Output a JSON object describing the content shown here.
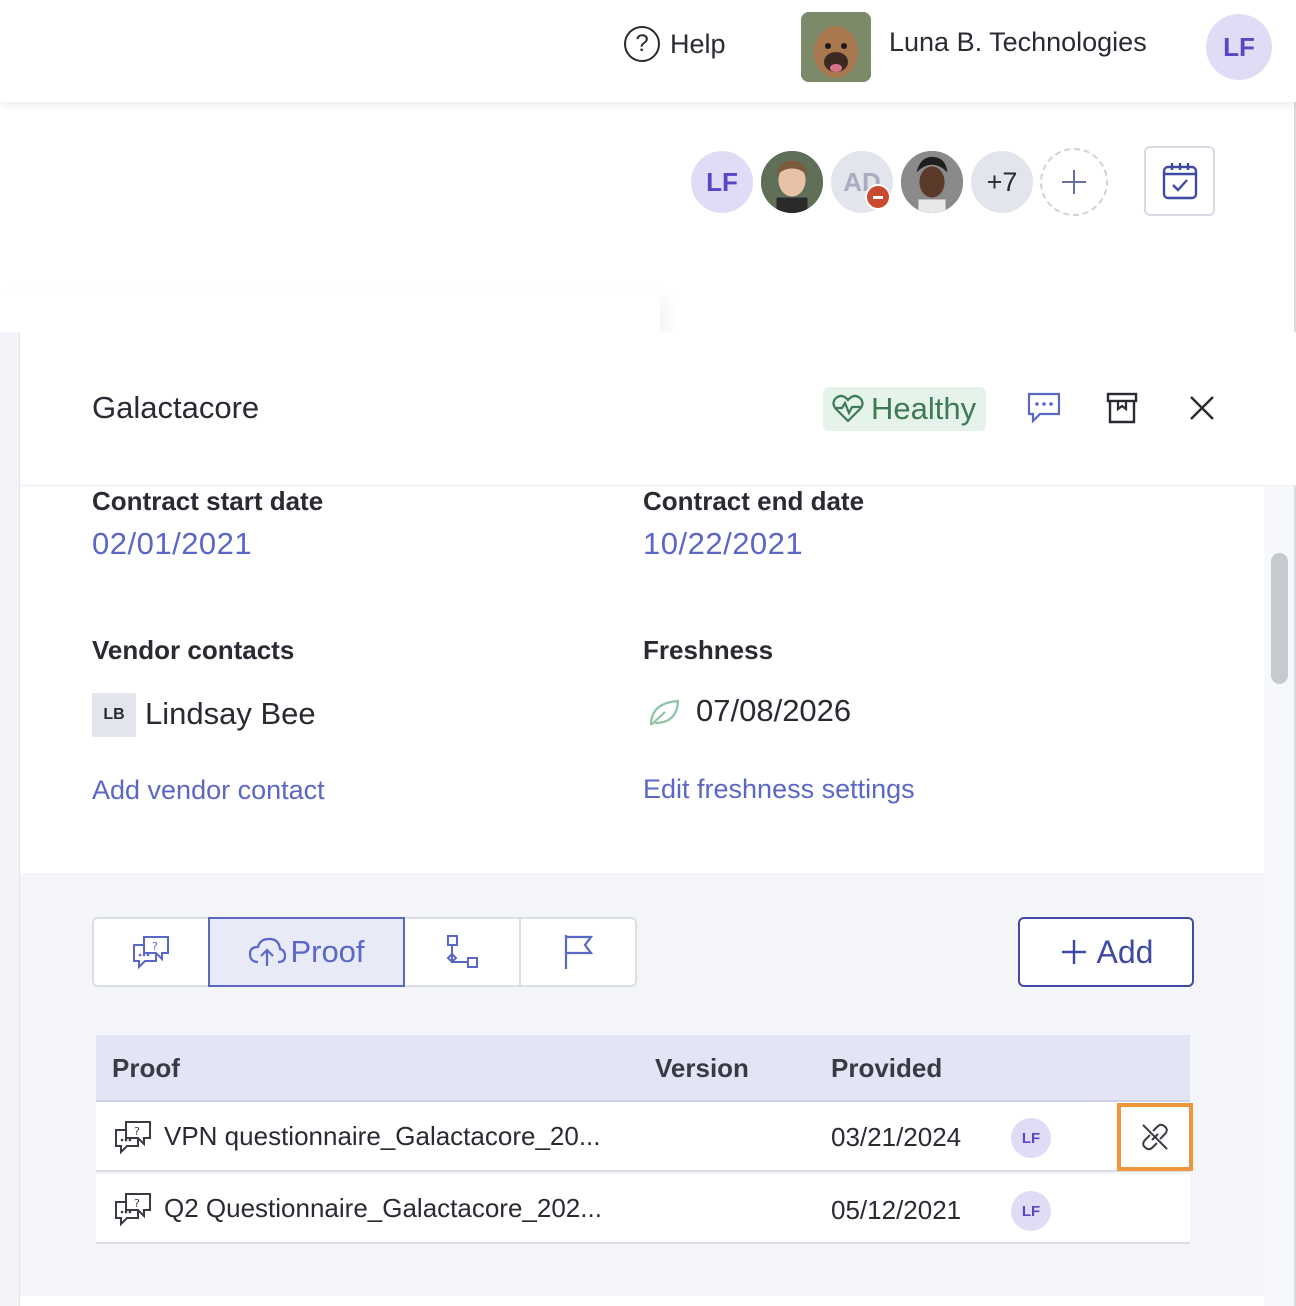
{
  "topbar": {
    "help_label": "Help",
    "org_name": "Luna B. Technologies",
    "user_initials": "LF"
  },
  "team": {
    "members": [
      {
        "initials": "LF"
      },
      {
        "initials": ""
      },
      {
        "initials": "AD"
      },
      {
        "initials": ""
      }
    ],
    "more_count": "+7"
  },
  "vendor": {
    "name": "Galactacore",
    "health": "Healthy"
  },
  "details": {
    "contract_start_label": "Contract start date",
    "contract_start_value": "02/01/2021",
    "contract_end_label": "Contract end date",
    "contract_end_value": "10/22/2021",
    "vendor_contacts_label": "Vendor contacts",
    "contact_initials": "LB",
    "contact_name": "Lindsay Bee",
    "add_contact_link": "Add vendor contact",
    "freshness_label": "Freshness",
    "freshness_value": "07/08/2026",
    "edit_freshness_link": "Edit freshness settings"
  },
  "tabs": {
    "active_label": "Proof",
    "add_label": "Add"
  },
  "table": {
    "headers": {
      "proof": "Proof",
      "version": "Version",
      "provided": "Provided"
    },
    "rows": [
      {
        "name": "VPN questionnaire_Galactacore_20...",
        "version": "",
        "provided": "03/21/2024",
        "owner": "LF"
      },
      {
        "name": "Q2 Questionnaire_Galactacore_202...",
        "version": "",
        "provided": "05/12/2021",
        "owner": "LF"
      }
    ]
  },
  "colors": {
    "accent": "#5b67c7",
    "accent_dark": "#3f4aa3",
    "healthy_bg": "#e6f3ea",
    "healthy_text": "#3e7a55",
    "highlight": "#f0963a"
  }
}
